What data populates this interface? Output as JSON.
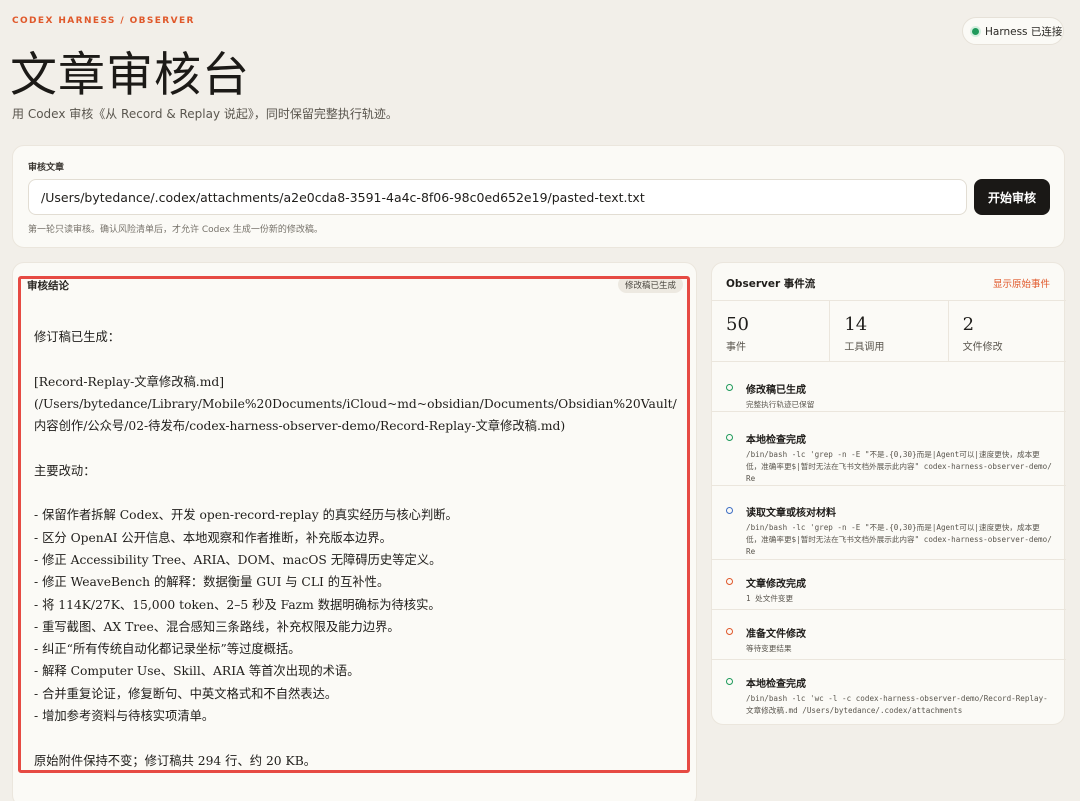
{
  "header": {
    "eyebrow": "CODEX HARNESS / OBSERVER",
    "title": "文章审核台",
    "subtitle": "用 Codex 审核《从 Record & Replay 说起》，同时保留完整执行轨迹。",
    "connection_status": "Harness 已连接"
  },
  "colors": {
    "accent": "#e0582a",
    "success": "#1f9a5b",
    "info": "#3f6fc4",
    "warning": "#e0582a",
    "highlight_border": "#e64a43"
  },
  "input_panel": {
    "label": "审核文章",
    "path_value": "/Users/bytedance/.codex/attachments/a2e0cda8-3591-4a4c-8f06-98c0ed652e19/pasted-text.txt",
    "start_button_label": "开始审核",
    "hint": "第一轮只读审核。确认风险清单后，才允许 Codex 生成一份新的修改稿。"
  },
  "result_panel": {
    "title": "审核结论",
    "badge": "修改稿已生成",
    "intro": "修订稿已生成：",
    "file_link": "[Record-Replay-文章修改稿.md]",
    "file_path": "(/Users/bytedance/Library/Mobile%20Documents/iCloud~md~obsidian/Documents/Obsidian%20Vault/内容创作/公众号/02-待发布/codex-harness-observer-demo/Record-Replay-文章修改稿.md)",
    "changes_heading": "主要改动：",
    "changes": [
      "- 保留作者拆解 Codex、开发 open-record-replay 的真实经历与核心判断。",
      "- 区分 OpenAI 公开信息、本地观察和作者推断，补充版本边界。",
      "- 修正 Accessibility Tree、ARIA、DOM、macOS 无障碍历史等定义。",
      "- 修正 WeaveBench 的解释：数据衡量 GUI 与 CLI 的互补性。",
      "- 将 114K/27K、15,000 token、2–5 秒及 Fazm 数据明确标为待核实。",
      "- 重写截图、AX Tree、混合感知三条路线，补充权限及能力边界。",
      "- 纠正“所有传统自动化都记录坐标”等过度概括。",
      "- 解释 Computer Use、Skill、ARIA 等首次出现的术语。",
      "- 合并重复论证，修复断句、中英文格式和不自然表达。",
      "- 增加参考资料与待核实项清单。"
    ],
    "closing": "原始附件保持不变；修订稿共 294 行、约 20 KB。"
  },
  "observer": {
    "title": "Observer 事件流",
    "show_raw_label": "显示原始事件",
    "stats": [
      {
        "value": "50",
        "label": "事件"
      },
      {
        "value": "14",
        "label": "工具调用"
      },
      {
        "value": "2",
        "label": "文件修改"
      }
    ],
    "events": [
      {
        "title": "修改稿已生成",
        "detail": "完整执行轨迹已保留",
        "status": "success"
      },
      {
        "title": "本地检查完成",
        "detail": "/bin/bash -lc 'grep -n -E \"不是.{0,30}而是|Agent可以|速度更快，成本更低，准确率更$|暂时无法在飞书文档外展示此内容\" codex-harness-observer-demo/Re",
        "status": "success"
      },
      {
        "title": "读取文章或核对材料",
        "detail": "/bin/bash -lc 'grep -n -E \"不是.{0,30}而是|Agent可以|速度更快，成本更低，准确率更$|暂时无法在飞书文档外展示此内容\" codex-harness-observer-demo/Re",
        "status": "info"
      },
      {
        "title": "文章修改完成",
        "detail": "1 处文件变更",
        "status": "warning"
      },
      {
        "title": "准备文件修改",
        "detail": "等待变更结果",
        "status": "warning"
      },
      {
        "title": "本地检查完成",
        "detail": "/bin/bash -lc 'wc -l -c codex-harness-observer-demo/Record-Replay-文章修改稿.md /Users/bytedance/.codex/attachments",
        "status": "success"
      }
    ]
  }
}
